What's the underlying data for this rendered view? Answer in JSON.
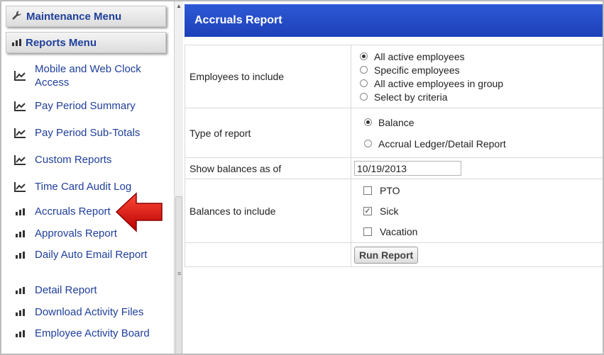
{
  "sidebar": {
    "maintenance_menu": {
      "label": "Maintenance Menu",
      "icon": "wrench-icon"
    },
    "reports_menu": {
      "label": "Reports Menu",
      "icon": "bar-chart-icon"
    },
    "items": [
      {
        "label": "Mobile and Web Clock Access",
        "icon": "line-chart-icon"
      },
      {
        "label": "Pay Period Summary",
        "icon": "line-chart-icon"
      },
      {
        "label": "Pay Period Sub-Totals",
        "icon": "line-chart-icon"
      },
      {
        "label": "Custom Reports",
        "icon": "line-chart-icon"
      },
      {
        "label": "Time Card Audit Log",
        "icon": "line-chart-icon"
      },
      {
        "label": "Accruals Report",
        "icon": "bar-chart-icon"
      },
      {
        "label": "Approvals Report",
        "icon": "bar-chart-icon"
      },
      {
        "label": "Daily Auto Email Report",
        "icon": "bar-chart-icon"
      },
      {
        "label": "Detail Report",
        "icon": "bar-chart-icon"
      },
      {
        "label": "Download Activity Files",
        "icon": "bar-chart-icon"
      },
      {
        "label": "Employee Activity Board",
        "icon": "bar-chart-icon"
      }
    ]
  },
  "main": {
    "title": "Accruals Report",
    "employees": {
      "label": "Employees to include",
      "options": [
        "All active employees",
        "Specific employees",
        "All active employees in group",
        "Select by criteria"
      ],
      "selected": "All active employees"
    },
    "report_type": {
      "label": "Type of report",
      "options": [
        "Balance",
        "Accrual Ledger/Detail Report"
      ],
      "selected": "Balance"
    },
    "balances_as_of": {
      "label": "Show balances as of",
      "value": "10/19/2013"
    },
    "balances": {
      "label": "Balances to include",
      "options": [
        {
          "label": "PTO",
          "checked": false
        },
        {
          "label": "Sick",
          "checked": true
        },
        {
          "label": "Vacation",
          "checked": false
        }
      ]
    },
    "run_button": "Run Report"
  },
  "colors": {
    "title_bar": "#1d3fb8",
    "link": "#1f3f9a",
    "arrow": "#d40000"
  }
}
